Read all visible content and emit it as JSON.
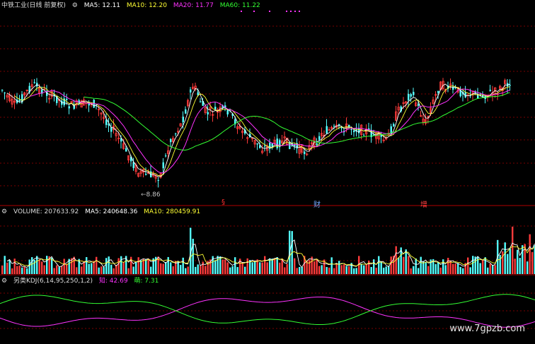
{
  "header": {
    "stock": "中铁工业(日线 前复权)",
    "ma5_label": "MA5: 12.11",
    "ma10_label": "MA10: 12.20",
    "ma20_label": "MA20: 11.77",
    "ma60_label": "MA60: 11.22"
  },
  "price_panel": {
    "low_marker": "8.86",
    "events": [
      {
        "text": "§",
        "color": "#ff3030"
      },
      {
        "text": "财",
        "color": "#6fa8ff"
      },
      {
        "text": "增",
        "color": "#ff4040"
      }
    ]
  },
  "volume_panel": {
    "title": "VOLUME: 207633.92",
    "ma5_label": "MA5: 240648.36",
    "ma10_label": "MA10: 280459.91"
  },
  "kdj_panel": {
    "title": "另类KDJ(6,14,95,250,1,2)",
    "line1_label": "知: 42.69",
    "line2_label": "萌: 7.31"
  },
  "watermark": "www.7gpzb.com",
  "colors": {
    "up": "#ff3b3b",
    "down": "#54ffff",
    "ma5": "#ffffff",
    "ma10": "#ffff33",
    "ma20": "#ff33ff",
    "ma60": "#33ff33",
    "grid": "#7a0000"
  }
}
